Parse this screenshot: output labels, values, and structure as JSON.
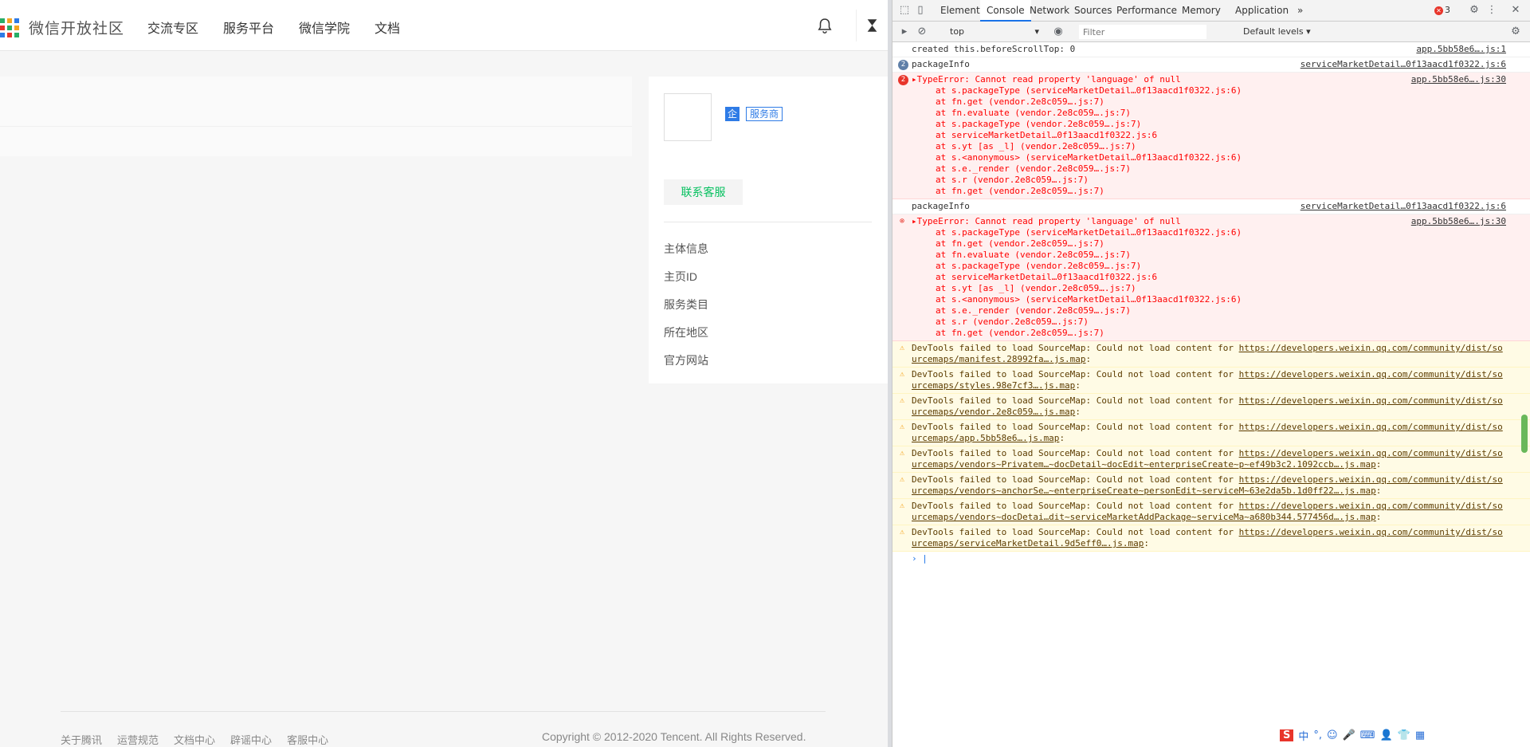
{
  "site": {
    "logo_text": "微信开放社区",
    "nav": [
      "交流专区",
      "服务平台",
      "微信学院",
      "文档"
    ],
    "badges": {
      "enterprise": "企",
      "provider": "服务商"
    },
    "contact_button": "联系客服",
    "info_items": [
      "主体信息",
      "主页ID",
      "服务类目",
      "所在地区",
      "官方网站"
    ],
    "footer_links": [
      "关于腾讯",
      "运营规范",
      "文档中心",
      "辟谣中心",
      "客服中心"
    ],
    "copyright": "Copyright © 2012-2020 Tencent. All Rights Reserved.",
    "colors": {
      "accent_green": "#07c160",
      "badge_blue": "#2e7be6"
    }
  },
  "devtools": {
    "tabs": [
      "Elements",
      "Console",
      "Network",
      "Sources",
      "Performance",
      "Memory",
      "Application"
    ],
    "active_tab": "Console",
    "more_tabs": "»",
    "error_count": "3",
    "context": "top",
    "filter_placeholder": "Filter",
    "levels": "Default levels",
    "messages": [
      {
        "type": "log",
        "text": "created this.beforeScrollTop: 0",
        "source": "app.5bb58e6….js:1"
      },
      {
        "type": "log",
        "repeat": "2",
        "text": "packageInfo",
        "source": "serviceMarketDetail…0f13aacd1f0322.js:6"
      },
      {
        "type": "error",
        "repeat": "2",
        "text": "▸TypeError: Cannot read property 'language' of null",
        "source": "app.5bb58e6….js:30",
        "stack": [
          "at s.packageType (serviceMarketDetail…0f13aacd1f0322.js:6)",
          "at fn.get (vendor.2e8c059….js:7)",
          "at fn.evaluate (vendor.2e8c059….js:7)",
          "at s.packageType (vendor.2e8c059….js:7)",
          "at serviceMarketDetail…0f13aacd1f0322.js:6",
          "at s.yt [as _l] (vendor.2e8c059….js:7)",
          "at s.<anonymous> (serviceMarketDetail…0f13aacd1f0322.js:6)",
          "at s.e._render (vendor.2e8c059….js:7)",
          "at s.r (vendor.2e8c059….js:7)",
          "at fn.get (vendor.2e8c059….js:7)"
        ]
      },
      {
        "type": "log",
        "text": "packageInfo",
        "source": "serviceMarketDetail…0f13aacd1f0322.js:6"
      },
      {
        "type": "error",
        "text": "▸TypeError: Cannot read property 'language' of null",
        "source": "app.5bb58e6….js:30",
        "stack": [
          "at s.packageType (serviceMarketDetail…0f13aacd1f0322.js:6)",
          "at fn.get (vendor.2e8c059….js:7)",
          "at fn.evaluate (vendor.2e8c059….js:7)",
          "at s.packageType (vendor.2e8c059….js:7)",
          "at serviceMarketDetail…0f13aacd1f0322.js:6",
          "at s.yt [as _l] (vendor.2e8c059….js:7)",
          "at s.<anonymous> (serviceMarketDetail…0f13aacd1f0322.js:6)",
          "at s.e._render (vendor.2e8c059….js:7)",
          "at s.r (vendor.2e8c059….js:7)",
          "at fn.get (vendor.2e8c059….js:7)"
        ]
      },
      {
        "type": "warn",
        "text": "DevTools failed to load SourceMap: Could not load content for ",
        "url": "https://developers.weixin.qq.com/community/dist/sourcemaps/manifest.28992fa….js.map"
      },
      {
        "type": "warn",
        "text": "DevTools failed to load SourceMap: Could not load content for ",
        "url": "https://developers.weixin.qq.com/community/dist/sourcemaps/styles.98e7cf3….js.map"
      },
      {
        "type": "warn",
        "text": "DevTools failed to load SourceMap: Could not load content for ",
        "url": "https://developers.weixin.qq.com/community/dist/sourcemaps/vendor.2e8c059….js.map"
      },
      {
        "type": "warn",
        "text": "DevTools failed to load SourceMap: Could not load content for ",
        "url": "https://developers.weixin.qq.com/community/dist/sourcemaps/app.5bb58e6….js.map"
      },
      {
        "type": "warn",
        "text": "DevTools failed to load SourceMap: Could not load content for ",
        "url": "https://developers.weixin.qq.com/community/dist/sourcemaps/vendors~Privatem…~docDetail~docEdit~enterpriseCreate~p~ef49b3c2.1092ccb….js.map"
      },
      {
        "type": "warn",
        "text": "DevTools failed to load SourceMap: Could not load content for ",
        "url": "https://developers.weixin.qq.com/community/dist/sourcemaps/vendors~anchorSe…~enterpriseCreate~personEdit~serviceM~63e2da5b.1d0ff22….js.map"
      },
      {
        "type": "warn",
        "text": "DevTools failed to load SourceMap: Could not load content for ",
        "url": "https://developers.weixin.qq.com/community/dist/sourcemaps/vendors~docDetai…dit~serviceMarketAddPackage~serviceMa~a680b344.577456d….js.map"
      },
      {
        "type": "warn",
        "text": "DevTools failed to load SourceMap: Could not load content for ",
        "url": "https://developers.weixin.qq.com/community/dist/sourcemaps/serviceMarketDetail.9d5eff0….js.map"
      }
    ],
    "prompt": "›",
    "ime_label": "中"
  }
}
